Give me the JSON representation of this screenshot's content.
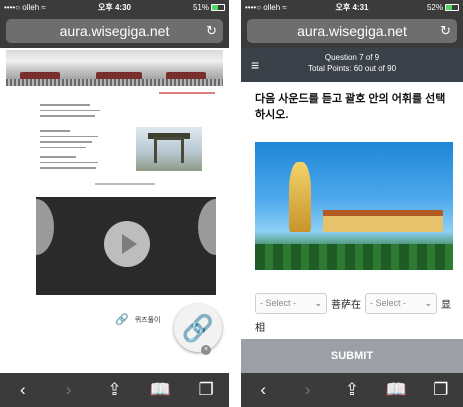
{
  "left_phone": {
    "status": {
      "carrier": "••••○ olleh ≈",
      "time": "오후 4:30",
      "battery": "51%"
    },
    "url": "aura.wisegiga.net",
    "icons": {
      "reload": "reload-icon",
      "play": "play-icon",
      "link": "link-chain-icon",
      "close": "close-icon"
    },
    "quiz_link_label": "퀴즈풀이",
    "fab_icon": "🔗",
    "fab_close": "×"
  },
  "right_phone": {
    "status": {
      "carrier": "••••○ olleh ≈",
      "time": "오후 4:31",
      "battery": "52%"
    },
    "url": "aura.wisegiga.net",
    "quiz": {
      "question": "Question 7 of 9",
      "points": "Total Points: 60 out of 90",
      "instruction": "다음 사운드를 듣고 괄호 안의 어휘를 선택하시오.",
      "select1": "- Select -",
      "middle_text": "菩萨在",
      "select2": "- Select -",
      "after_text": "显",
      "tail_text": "相",
      "submit": "SUBMIT"
    }
  },
  "toolbar": {
    "back": "‹",
    "forward": "›",
    "share": "⇪",
    "bookmarks": "📖",
    "tabs": "❐"
  },
  "colors": {
    "bar": "#3b3b3b",
    "quiz_header": "#3b4148",
    "submit": "#9c9fa5",
    "battery": "#4cd964"
  }
}
